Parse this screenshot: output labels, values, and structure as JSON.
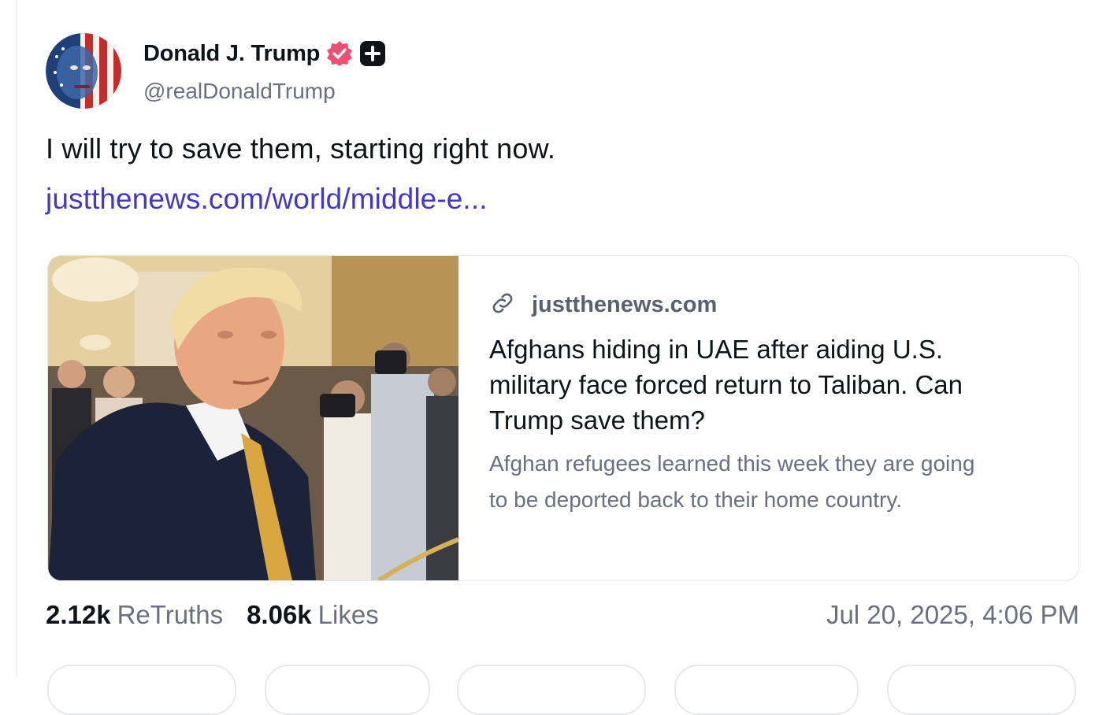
{
  "post": {
    "display_name": "Donald J. Trump",
    "handle": "@realDonaldTrump",
    "text": "I will try to save them, starting right now.",
    "link_text": "justthenews.com/world/middle-e..."
  },
  "card": {
    "domain": "justthenews.com",
    "title": "Afghans hiding in UAE after aiding U.S. military face forced return to Taliban. Can Trump save them?",
    "description": "Afghan refugees learned this week they are going to be deported back to their home country."
  },
  "stats": {
    "retruths_count": "2.12k",
    "retruths_label": "ReTruths",
    "likes_count": "8.06k",
    "likes_label": "Likes",
    "timestamp": "Jul 20, 2025, 4:06 PM"
  },
  "icons": {
    "verified": "verified-badge-icon",
    "plus": "plus-badge-icon",
    "link": "link-icon"
  },
  "colors": {
    "link": "#4337c9",
    "verified": "#f04f74",
    "muted": "#6b6f80"
  }
}
